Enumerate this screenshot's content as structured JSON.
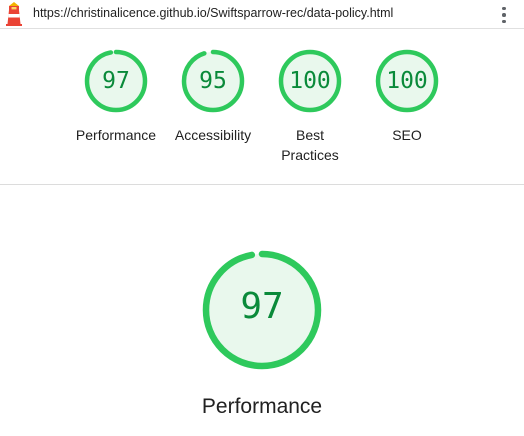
{
  "browser": {
    "url": "https://christinalicence.github.io/Swiftsparrow-rec/data-policy.html",
    "logo_icon": "lighthouse-icon",
    "menu_icon": "more-vert-icon"
  },
  "colors": {
    "pass_stroke": "#2ec95c",
    "pass_fill": "#e9f8ed",
    "pass_text": "#0a8a3a"
  },
  "summary": [
    {
      "id": "performance",
      "score": "97",
      "label": "Performance",
      "fraction": 0.97
    },
    {
      "id": "accessibility",
      "score": "95",
      "label": "Accessibility",
      "fraction": 0.95
    },
    {
      "id": "best-practices",
      "score": "100",
      "label": "Best\nPractices",
      "fraction": 1.0
    },
    {
      "id": "seo",
      "score": "100",
      "label": "SEO",
      "fraction": 1.0
    }
  ],
  "detail": {
    "score": "97",
    "fraction": 0.97,
    "title": "Performance"
  }
}
